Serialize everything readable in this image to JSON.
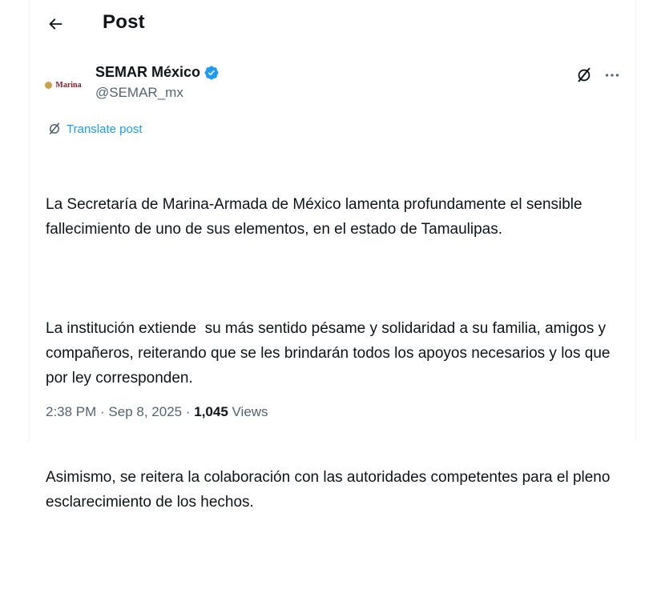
{
  "header": {
    "back_icon": "arrow-left-icon",
    "title": "Post"
  },
  "author": {
    "avatar_text": "Marina",
    "display_name": "SEMAR México",
    "verified_icon": "verified-badge-icon",
    "verified_color": "#1d9bf0",
    "handle": "@SEMAR_mx",
    "grok_icon": "grok-icon",
    "more_icon": "more-icon"
  },
  "translate": {
    "icon": "translate-icon",
    "label": "Translate post",
    "color": "#1d9bf0"
  },
  "tweet": {
    "paragraphs": [
      "La Secretaría de Marina-Armada de México lamenta profundamente el sensible fallecimiento de uno de sus elementos, en el estado de Tamaulipas.",
      "La institución extiende  su más sentido pésame y solidaridad a su familia, amigos y compañeros, reiterando que se les brindarán todos los apoyos necesarios y los que por ley corresponden.",
      "Asimismo, se reitera la colaboración con las autoridades competentes para el pleno esclarecimiento de los hechos."
    ]
  },
  "meta": {
    "time": "2:38 PM",
    "separator": " · ",
    "date": "Sep 8, 2025",
    "views_count": "1,045",
    "views_label": "Views"
  }
}
